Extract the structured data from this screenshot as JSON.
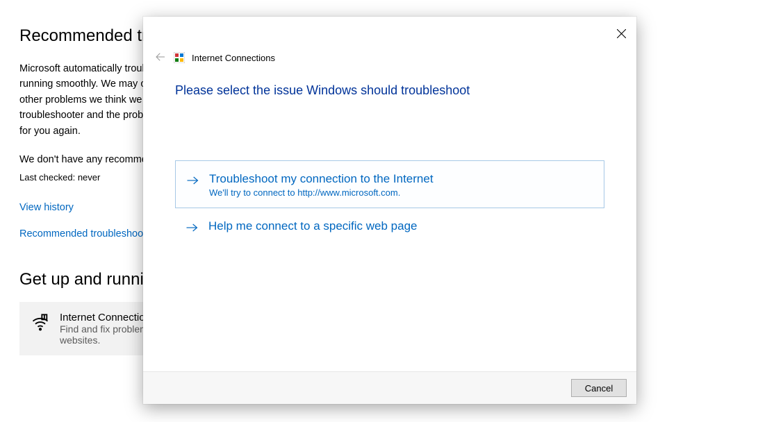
{
  "background": {
    "heading1": "Recommended troubleshooting",
    "paragraph": "Microsoft automatically troubleshoots problems on your device to keep it running smoothly. We may occasionally show recommendations below for other problems we think we can fix. If you run a recommended troubleshooter and the problem comes back, we'll automatically try to fix it for you again.",
    "noRecs": "We don't have any recommendations right now",
    "lastChecked": "Last checked: never",
    "viewHistory": "View history",
    "recTroubleshooting": "Recommended troubleshooting history",
    "heading2": "Get up and running",
    "card": {
      "title": "Internet Connections",
      "sub": "Find and fix problems with connecting to the Internet or to websites."
    }
  },
  "dialog": {
    "title": "Internet Connections",
    "question": "Please select the issue Windows should troubleshoot",
    "option1": {
      "title": "Troubleshoot my connection to the Internet",
      "sub": "We'll try to connect to http://www.microsoft.com."
    },
    "option2": {
      "title": "Help me connect to a specific web page"
    },
    "cancel": "Cancel"
  }
}
